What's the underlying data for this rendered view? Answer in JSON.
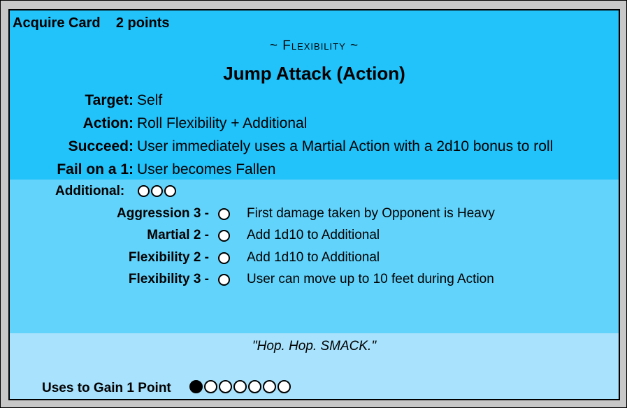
{
  "card": {
    "acquire_label": "Acquire Card",
    "acquire_points": "2 points",
    "category": "~ Flexibility ~",
    "title": "Jump Attack (Action)",
    "rows": [
      {
        "label": "Target:",
        "value": "Self"
      },
      {
        "label": "Action:",
        "value": "Roll Flexibility + Additional"
      },
      {
        "label": "Succeed:",
        "value": "User immediately uses a Martial Action with a 2d10 bonus to roll"
      },
      {
        "label": "Fail on a 1:",
        "value": "User becomes Fallen"
      }
    ],
    "additional_label": "Additional:",
    "additional_circles": 3,
    "options": [
      {
        "label": "Aggression 3 -",
        "text": "First damage taken by Opponent is Heavy"
      },
      {
        "label": "Martial 2 -",
        "text": "Add 1d10 to Additional"
      },
      {
        "label": "Flexibility 2 -",
        "text": "Add 1d10 to Additional"
      },
      {
        "label": "Flexibility 3 -",
        "text": "User can move up to 10 feet during Action"
      }
    ],
    "quote": "\"Hop. Hop. SMACK.\"",
    "uses_label": "Uses to Gain 1 Point",
    "uses_total": 7,
    "uses_filled": 1
  },
  "colors": {
    "top_section": "#22c2fa",
    "middle_section": "#62d3fb",
    "bottom_section": "#a8e2fc"
  }
}
